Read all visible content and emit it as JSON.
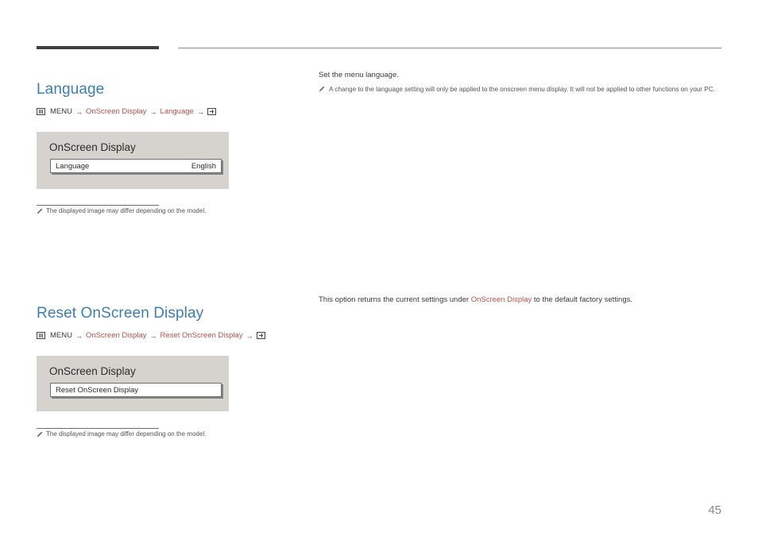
{
  "sections": [
    {
      "title": "Language",
      "breadcrumb": {
        "menu_label": "MENU",
        "crumb1": "OnScreen Display",
        "crumb2": "Language",
        "arrow": "→"
      },
      "panel": {
        "title": "OnScreen Display",
        "row_label": "Language",
        "row_value": "English"
      },
      "note": "The displayed image may differ depending on the model.",
      "right_intro": "Set the menu language.",
      "right_note": "A change to the language setting will only be applied to the onscreen menu display. It will not be applied to other functions on your PC."
    },
    {
      "title": "Reset OnScreen Display",
      "breadcrumb": {
        "menu_label": "MENU",
        "crumb1": "OnScreen Display",
        "crumb2": "Reset OnScreen Display",
        "arrow": "→"
      },
      "panel": {
        "title": "OnScreen Display",
        "row_label": "Reset OnScreen Display",
        "row_value": ""
      },
      "note": "The displayed image may differ depending on the model.",
      "right_text_parts": {
        "before": "This option returns the current settings under ",
        "link": "OnScreen Display",
        "after": " to the default factory settings."
      }
    }
  ],
  "page_number": "45",
  "colors": {
    "heading": "#3d7fb5",
    "link": "#c0504d",
    "panel_bg": "#d6d3ce"
  }
}
